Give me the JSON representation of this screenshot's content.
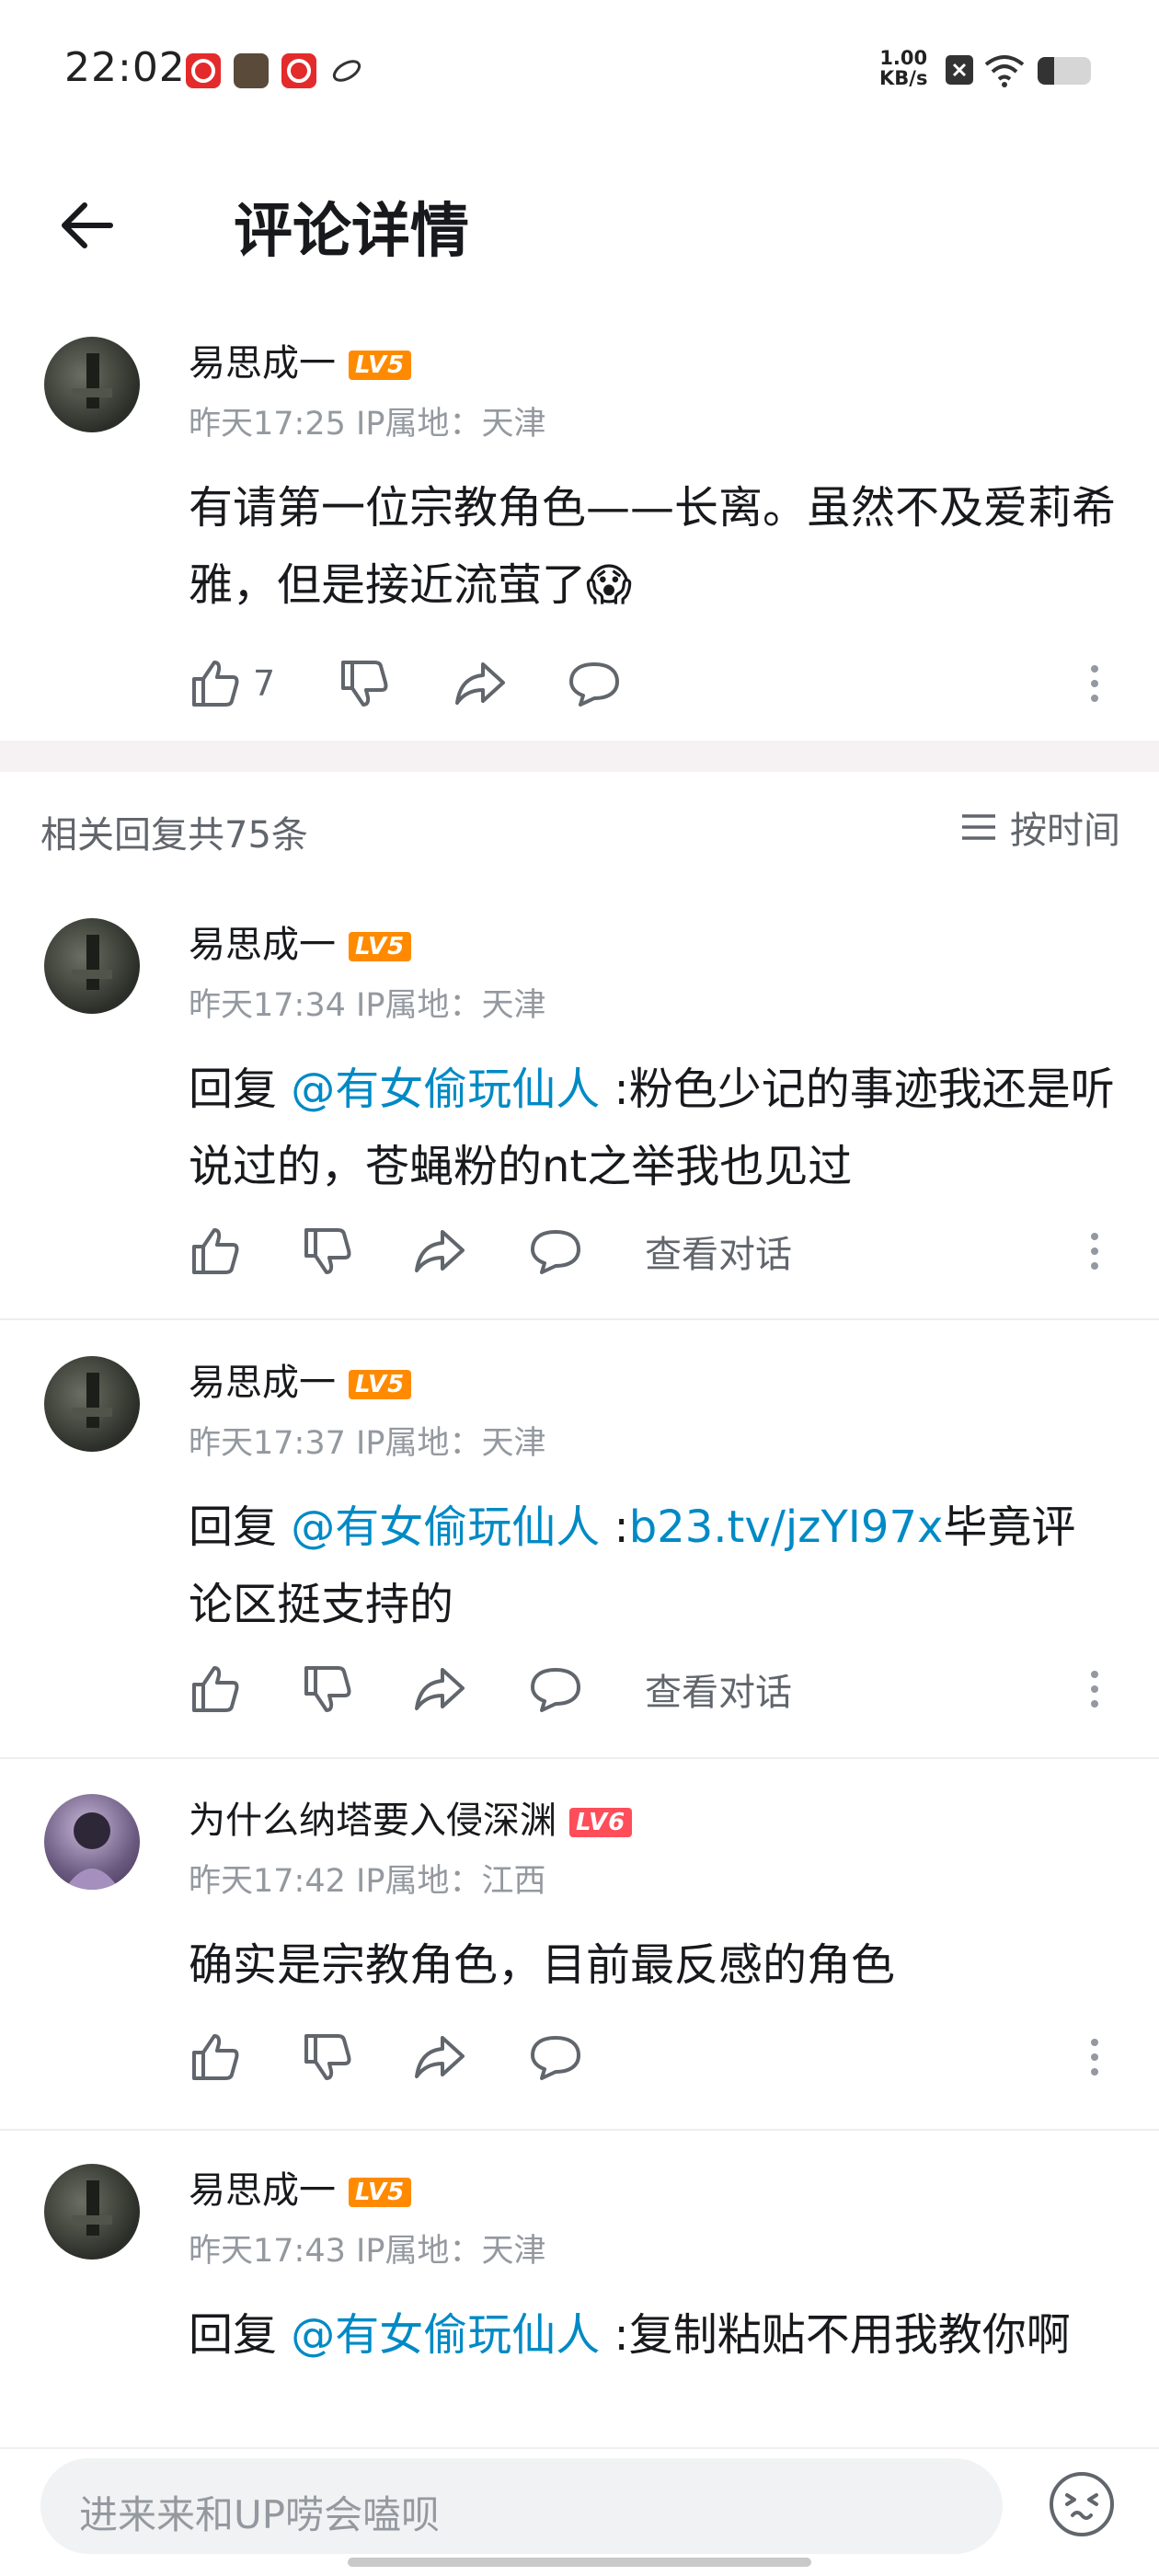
{
  "status_bar": {
    "time": "22:02",
    "net_speed_value": "1.00",
    "net_speed_unit": "KB/s"
  },
  "header": {
    "title": "评论详情"
  },
  "root_comment": {
    "username": "易思成一",
    "level": "LV5",
    "time": "昨天17:25",
    "ip": "IP属地：天津",
    "text": "有请第一位宗教角色——长离。虽然不及爱莉希雅，但是接近流萤了",
    "emoji": "😱",
    "like_count": "7"
  },
  "replies_header": {
    "count_label": "相关回复共75条",
    "sort_label": "按时间"
  },
  "replies": [
    {
      "username": "易思成一",
      "level": "LV5",
      "time": "昨天17:34",
      "ip": "IP属地：天津",
      "prefix": "回复 ",
      "mention": "@有女偷玩仙人",
      "text": " :粉色少记的事迹我还是听说过的，苍蝇粉的nt之举我也见过",
      "view_conversation": "查看对话"
    },
    {
      "username": "易思成一",
      "level": "LV5",
      "time": "昨天17:37",
      "ip": "IP属地：天津",
      "prefix": "回复 ",
      "mention": "@有女偷玩仙人",
      "sep": " :",
      "link": "b23.tv/jzYI97x",
      "text": "毕竟评论区挺支持的",
      "view_conversation": "查看对话"
    },
    {
      "username": "为什么纳塔要入侵深渊",
      "level": "LV6",
      "time": "昨天17:42",
      "ip": "IP属地：江西",
      "text": "确实是宗教角色，目前最反感的角色"
    },
    {
      "username": "易思成一",
      "level": "LV5",
      "time": "昨天17:43",
      "ip": "IP属地：天津",
      "prefix": "回复 ",
      "mention": "@有女偷玩仙人",
      "text": " :复制粘贴不用我教你啊"
    }
  ],
  "input_bar": {
    "placeholder": "进来来和UP唠会嗑呗"
  },
  "colors": {
    "accent_link": "#008ac5",
    "lv5": "#ff8a00",
    "lv6": "#ff4d5a",
    "meta": "#9499a0"
  },
  "icons": [
    "back-arrow-icon",
    "like-icon",
    "dislike-icon",
    "share-icon",
    "reply-icon",
    "more-icon",
    "sort-icon",
    "emoji-icon",
    "wifi-icon",
    "battery-icon"
  ]
}
